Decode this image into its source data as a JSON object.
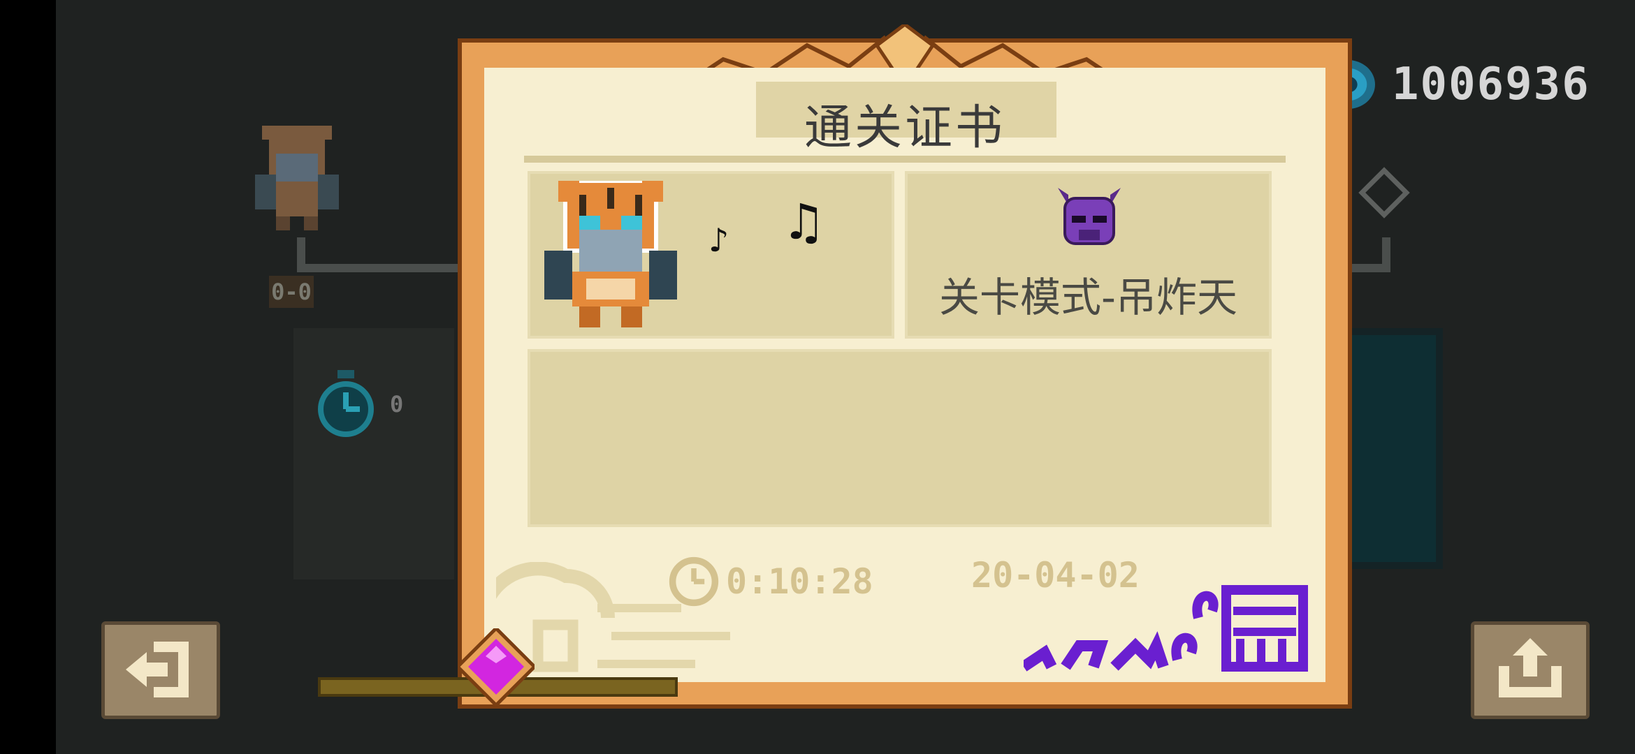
{
  "colors": {
    "background": "#1f2221",
    "certificate_paper": "#f7efd1",
    "certificate_frame": "#e8a158",
    "cell_fill": "#ded3a5",
    "currency_gem": "#2a8fb0",
    "signature": "#6a1fd0",
    "bottom_gem": "#e030f0"
  },
  "hud": {
    "currency_icon": "blue-gem-icon",
    "currency_value": "1006936"
  },
  "background_scene": {
    "score_text": "0-0",
    "timer_text": "0"
  },
  "certificate": {
    "title": "通关证书",
    "hero_icon": "tiger-character-icon",
    "music_note_large": "♫",
    "music_note_small": "♪",
    "mode_icon": "purple-demon-helmet-icon",
    "mode_label": "关卡模式-吊炸天",
    "time_value": "0:10:28",
    "date_value": "20-04-02"
  },
  "buttons": {
    "exit_icon": "exit-door-icon",
    "share_icon": "share-upload-icon"
  }
}
